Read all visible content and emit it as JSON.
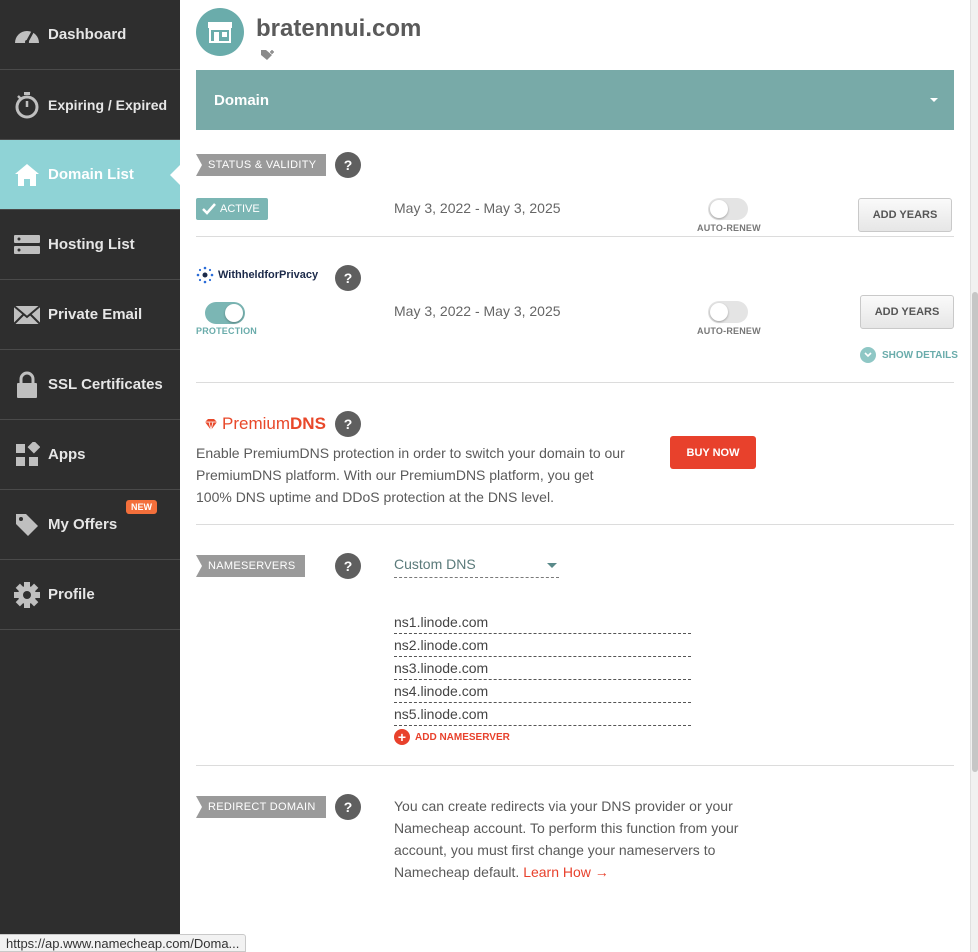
{
  "sidebar": {
    "items": [
      {
        "label": "Dashboard",
        "icon": "speedometer-icon"
      },
      {
        "label": "Expiring / Expired",
        "icon": "stopwatch-icon"
      },
      {
        "label": "Domain List",
        "icon": "home-icon",
        "active": true
      },
      {
        "label": "Hosting List",
        "icon": "server-icon"
      },
      {
        "label": "Private Email",
        "icon": "envelope-icon"
      },
      {
        "label": "SSL Certificates",
        "icon": "lock-icon"
      },
      {
        "label": "Apps",
        "icon": "apps-icon"
      },
      {
        "label": "My Offers",
        "icon": "tag-icon",
        "badge": "NEW"
      },
      {
        "label": "Profile",
        "icon": "gear-icon"
      }
    ]
  },
  "header": {
    "domain": "bratennui.com"
  },
  "domain_bar": {
    "label": "Domain"
  },
  "status": {
    "section_label": "STATUS & VALIDITY",
    "help": "?",
    "badge": "ACTIVE",
    "dates": "May 3, 2022 - May 3, 2025",
    "auto_renew_label": "AUTO-RENEW",
    "add_years": "ADD YEARS"
  },
  "privacy": {
    "logo_text": "WithheldforPrivacy",
    "help": "?",
    "protection_label": "PROTECTION",
    "dates": "May 3, 2022 - May 3, 2025",
    "auto_renew_label": "AUTO-RENEW",
    "add_years": "ADD YEARS",
    "show_details": "SHOW DETAILS"
  },
  "premium_dns": {
    "logo_premium": "Premium",
    "logo_dns": "DNS",
    "help": "?",
    "description": "Enable PremiumDNS protection in order to switch your domain to our PremiumDNS platform. With our PremiumDNS platform, you get 100% DNS uptime and DDoS protection at the DNS level.",
    "buy_now": "BUY NOW"
  },
  "nameservers": {
    "section_label": "NAMESERVERS",
    "help": "?",
    "dns_type": "Custom DNS",
    "list": [
      "ns1.linode.com",
      "ns2.linode.com",
      "ns3.linode.com",
      "ns4.linode.com",
      "ns5.linode.com"
    ],
    "add_label": "ADD NAMESERVER"
  },
  "redirect": {
    "section_label": "REDIRECT DOMAIN",
    "help": "?",
    "text": "You can create redirects via your DNS provider or your Namecheap account. To perform this function from your account, you must first change your nameservers to Namecheap default.",
    "learn_how": "Learn How →"
  },
  "status_bar": {
    "url": "https://ap.www.namecheap.com/Doma..."
  },
  "colors": {
    "sidebar_bg": "#2e2e2e",
    "active_nav": "#8fd3d6",
    "teal": "#78aaa8",
    "accent_red": "#e8412c"
  }
}
